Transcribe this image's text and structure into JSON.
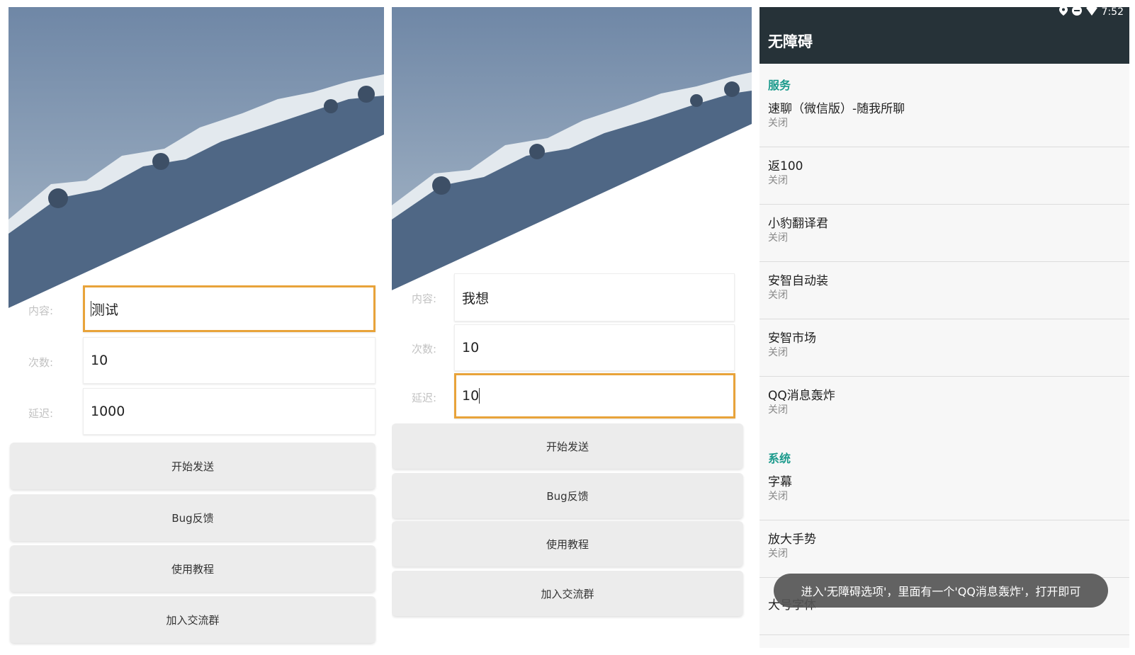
{
  "screen1": {
    "form": {
      "content_label": "内容:",
      "content_value": "测试",
      "count_label": "次数:",
      "count_value": "10",
      "delay_label": "延迟:",
      "delay_value": "1000"
    },
    "buttons": {
      "start": "开始发送",
      "bug": "Bug反馈",
      "tutorial": "使用教程",
      "join": "加入交流群"
    }
  },
  "screen2": {
    "form": {
      "content_label": "内容:",
      "content_value": "我想",
      "count_label": "次数:",
      "count_value": "10",
      "delay_label": "延迟:",
      "delay_value": "10"
    },
    "buttons": {
      "start": "开始发送",
      "bug": "Bug反馈",
      "tutorial": "使用教程",
      "join": "加入交流群"
    }
  },
  "screen3": {
    "status_time": "7:52",
    "title": "无障碍",
    "sections": {
      "services": "服务",
      "system": "系统"
    },
    "services": [
      {
        "title": "速聊（微信版）-随我所聊",
        "status": "关闭"
      },
      {
        "title": "返100",
        "status": "关闭"
      },
      {
        "title": " 小豹翻译君",
        "status": "关闭"
      },
      {
        "title": "安智自动装",
        "status": "关闭"
      },
      {
        "title": "安智市场",
        "status": "关闭"
      },
      {
        "title": "QQ消息轰炸",
        "status": "关闭"
      }
    ],
    "system": [
      {
        "title": "字幕",
        "status": "关闭"
      },
      {
        "title": "放大手势",
        "status": "关闭"
      },
      {
        "title": "大号字体"
      }
    ],
    "toast": "进入'无障碍选项'，里面有一个'QQ消息轰炸'，打开即可"
  },
  "colors": {
    "focus_border": "#e8a33a",
    "appbar": "#263238",
    "section_accent": "#1b9a8c",
    "button_bg": "#ececec",
    "mountain_shadow": "#4f6785",
    "sky": "#7e95b0"
  },
  "icons": [
    "location-icon",
    "minus-circle-icon",
    "wifi-icon"
  ]
}
